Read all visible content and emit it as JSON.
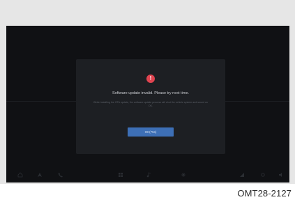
{
  "dialog": {
    "title": "Software update invalid. Please try next time.",
    "description": "While installing the OTA update, the software update process will shut the vehicle system and sound on OK.",
    "ok_label": "OK(75s)"
  },
  "bottom_bar": {
    "icons": [
      "home-icon",
      "navigation-icon",
      "phone-icon",
      "apps-icon",
      "media-icon",
      "climate-icon",
      "signal-icon",
      "settings-icon",
      "volume-icon"
    ]
  },
  "caption": "OMT28-2127",
  "colors": {
    "screen": "#101114",
    "dialog": "#1d1f23",
    "alert": "#e04450",
    "button": "#3d6fb6"
  }
}
